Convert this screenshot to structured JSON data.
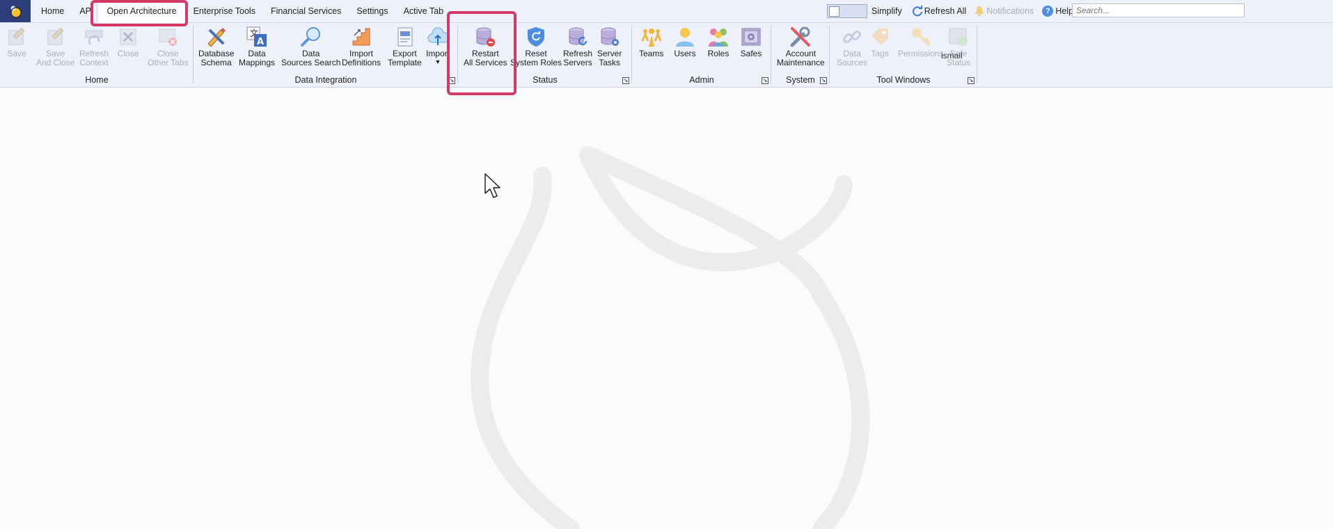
{
  "tabs": [
    {
      "label": "Home"
    },
    {
      "label": "API"
    },
    {
      "label": "Open Architecture"
    },
    {
      "label": "Enterprise Tools"
    },
    {
      "label": "Financial Services"
    },
    {
      "label": "Settings"
    },
    {
      "label": "Active Tab"
    }
  ],
  "toolbar_right": {
    "simplify": "Simplify",
    "refresh_all": "Refresh All",
    "notifications": "Notifications",
    "help": "Help"
  },
  "search": {
    "placeholder": "Search..."
  },
  "user": "ismail",
  "groups": {
    "home": {
      "label": "Home",
      "buttons": [
        {
          "label": "Save"
        },
        {
          "label": "Save\nAnd Close"
        },
        {
          "label": "Refresh\nContext"
        },
        {
          "label": "Close"
        },
        {
          "label": "Close\nOther Tabs"
        }
      ]
    },
    "data_integration": {
      "label": "Data Integration",
      "buttons": [
        {
          "label": "Database\nSchema"
        },
        {
          "label": "Data\nMappings"
        },
        {
          "label": "Data\nSources Search"
        },
        {
          "label": "Import\nDefinitions"
        },
        {
          "label": "Export\nTemplate"
        },
        {
          "label": "Import"
        }
      ]
    },
    "status": {
      "label": "Status",
      "buttons": [
        {
          "label": "Restart\nAll Services"
        },
        {
          "label": "Reset\nSystem Roles"
        },
        {
          "label": "Refresh\nServers"
        },
        {
          "label": "Server\nTasks"
        }
      ]
    },
    "admin": {
      "label": "Admin",
      "buttons": [
        {
          "label": "Teams"
        },
        {
          "label": "Users"
        },
        {
          "label": "Roles"
        },
        {
          "label": "Safes"
        }
      ]
    },
    "system": {
      "label": "System",
      "buttons": [
        {
          "label": "Account\nMaintenance"
        }
      ]
    },
    "tool_windows": {
      "label": "Tool Windows",
      "buttons": [
        {
          "label": "Data\nSources"
        },
        {
          "label": "Tags"
        },
        {
          "label": "Permissions"
        },
        {
          "label": "Safe\nStatus"
        }
      ]
    }
  },
  "colors": {
    "highlight": "#d33b66",
    "ribbon_bg": "#eef1fa",
    "logo_bg": "#2c3e7a"
  }
}
